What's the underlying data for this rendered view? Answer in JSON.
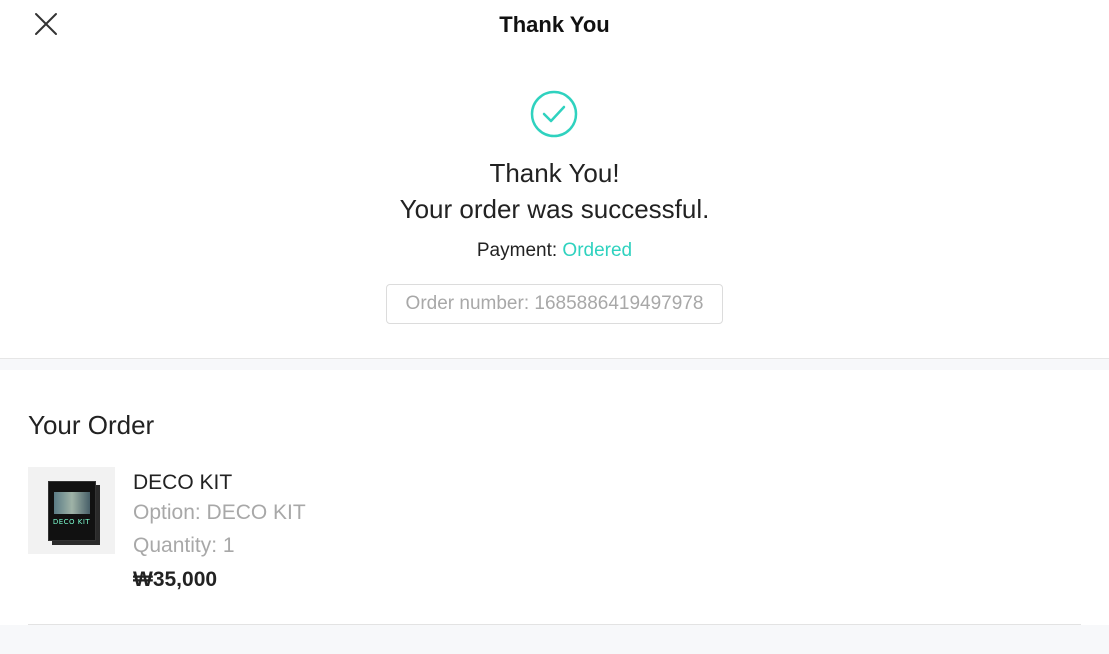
{
  "header": {
    "title": "Thank You",
    "close_icon": "close-icon"
  },
  "success": {
    "icon": "check-circle-icon",
    "accent_color": "#2fd2bf",
    "thanks": "Thank You!",
    "message": "Your order was successful.",
    "payment_label": "Payment:",
    "payment_status": "Ordered",
    "order_number": "Order number: 1685886419497978"
  },
  "order": {
    "section_title": "Your Order",
    "items": [
      {
        "name": "DECO KIT",
        "option": "Option: DECO KIT",
        "quantity": "Quantity: 1",
        "price": "₩35,000",
        "thumbnail": "deco-kit-product-image",
        "thumbnail_text": "DECO KIT"
      }
    ]
  }
}
